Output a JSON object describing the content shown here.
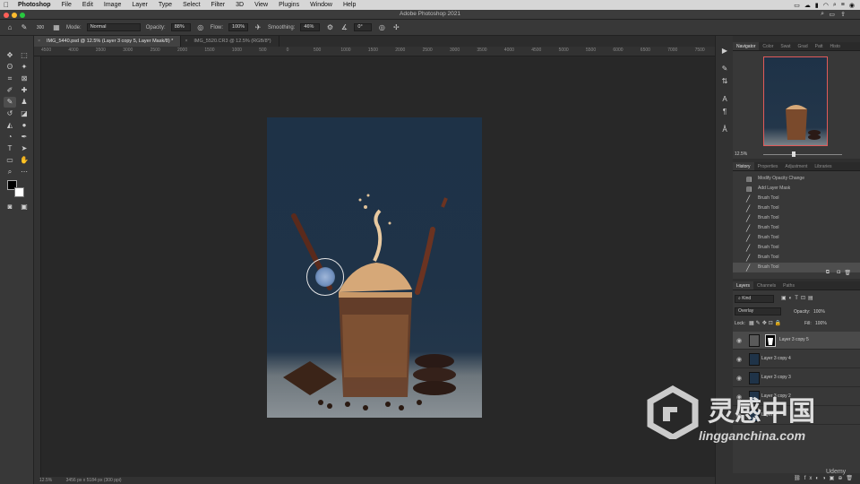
{
  "menubar": {
    "app": "Photoshop",
    "items": [
      "File",
      "Edit",
      "Image",
      "Layer",
      "Type",
      "Select",
      "Filter",
      "3D",
      "View",
      "Plugins",
      "Window",
      "Help"
    ]
  },
  "titlebar": {
    "title": "Adobe Photoshop 2021"
  },
  "options": {
    "mode_label": "Mode:",
    "mode_value": "Normal",
    "opacity_label": "Opacity:",
    "opacity_value": "88%",
    "flow_label": "Flow:",
    "flow_value": "100%",
    "smoothing_label": "Smoothing:",
    "smoothing_value": "46%",
    "angle_value": "0°",
    "brush_size": "300"
  },
  "tabs": [
    {
      "label": "IMG_5440.psd @ 12.5% (Layer 3 copy 5, Layer Mask/8) *"
    },
    {
      "label": "IMG_5520.CR3 @ 12.5% (RGB/8*)"
    }
  ],
  "ruler_ticks": [
    "4500",
    "4000",
    "3500",
    "3000",
    "2500",
    "2000",
    "1500",
    "1000",
    "500",
    "0",
    "500",
    "1000",
    "1500",
    "2000",
    "2500",
    "3000",
    "3500",
    "4000",
    "4500",
    "5000",
    "5500",
    "6000",
    "6500",
    "7000",
    "7500"
  ],
  "status": {
    "zoom": "12.5%",
    "doc": "3456 px x 5184 px (300 ppi)"
  },
  "navigator": {
    "tabs": [
      "Navigator",
      "Color",
      "Swat",
      "Grad",
      "Patt",
      "Histo"
    ],
    "zoom": "12.5%"
  },
  "history": {
    "tabs": [
      "History",
      "Properties",
      "Adjustment",
      "Libraries"
    ],
    "items": [
      "Modify Opacity Change",
      "Add Layer Mask",
      "Brush Tool",
      "Brush Tool",
      "Brush Tool",
      "Brush Tool",
      "Brush Tool",
      "Brush Tool",
      "Brush Tool",
      "Brush Tool"
    ]
  },
  "layers": {
    "tabs": [
      "Layers",
      "Channels",
      "Paths"
    ],
    "kind_label": "Kind",
    "blend_mode": "Overlay",
    "opacity_label": "Opacity:",
    "opacity_value": "100%",
    "lock_label": "Lock:",
    "fill_label": "Fill:",
    "fill_value": "100%",
    "rows": [
      "Layer 3 copy 5",
      "Layer 3 copy 4",
      "Layer 3 copy 3",
      "Layer 3 copy 2",
      "Layer 3"
    ]
  },
  "watermark": {
    "brand_cn": "灵感中国",
    "url": "lingganchina.com",
    "udemy": "Udemy"
  },
  "colors": {
    "accent": "#1473e6",
    "canvas_bg": "#282828",
    "panel_bg": "#383838",
    "photo_bg": "#1f3348"
  }
}
